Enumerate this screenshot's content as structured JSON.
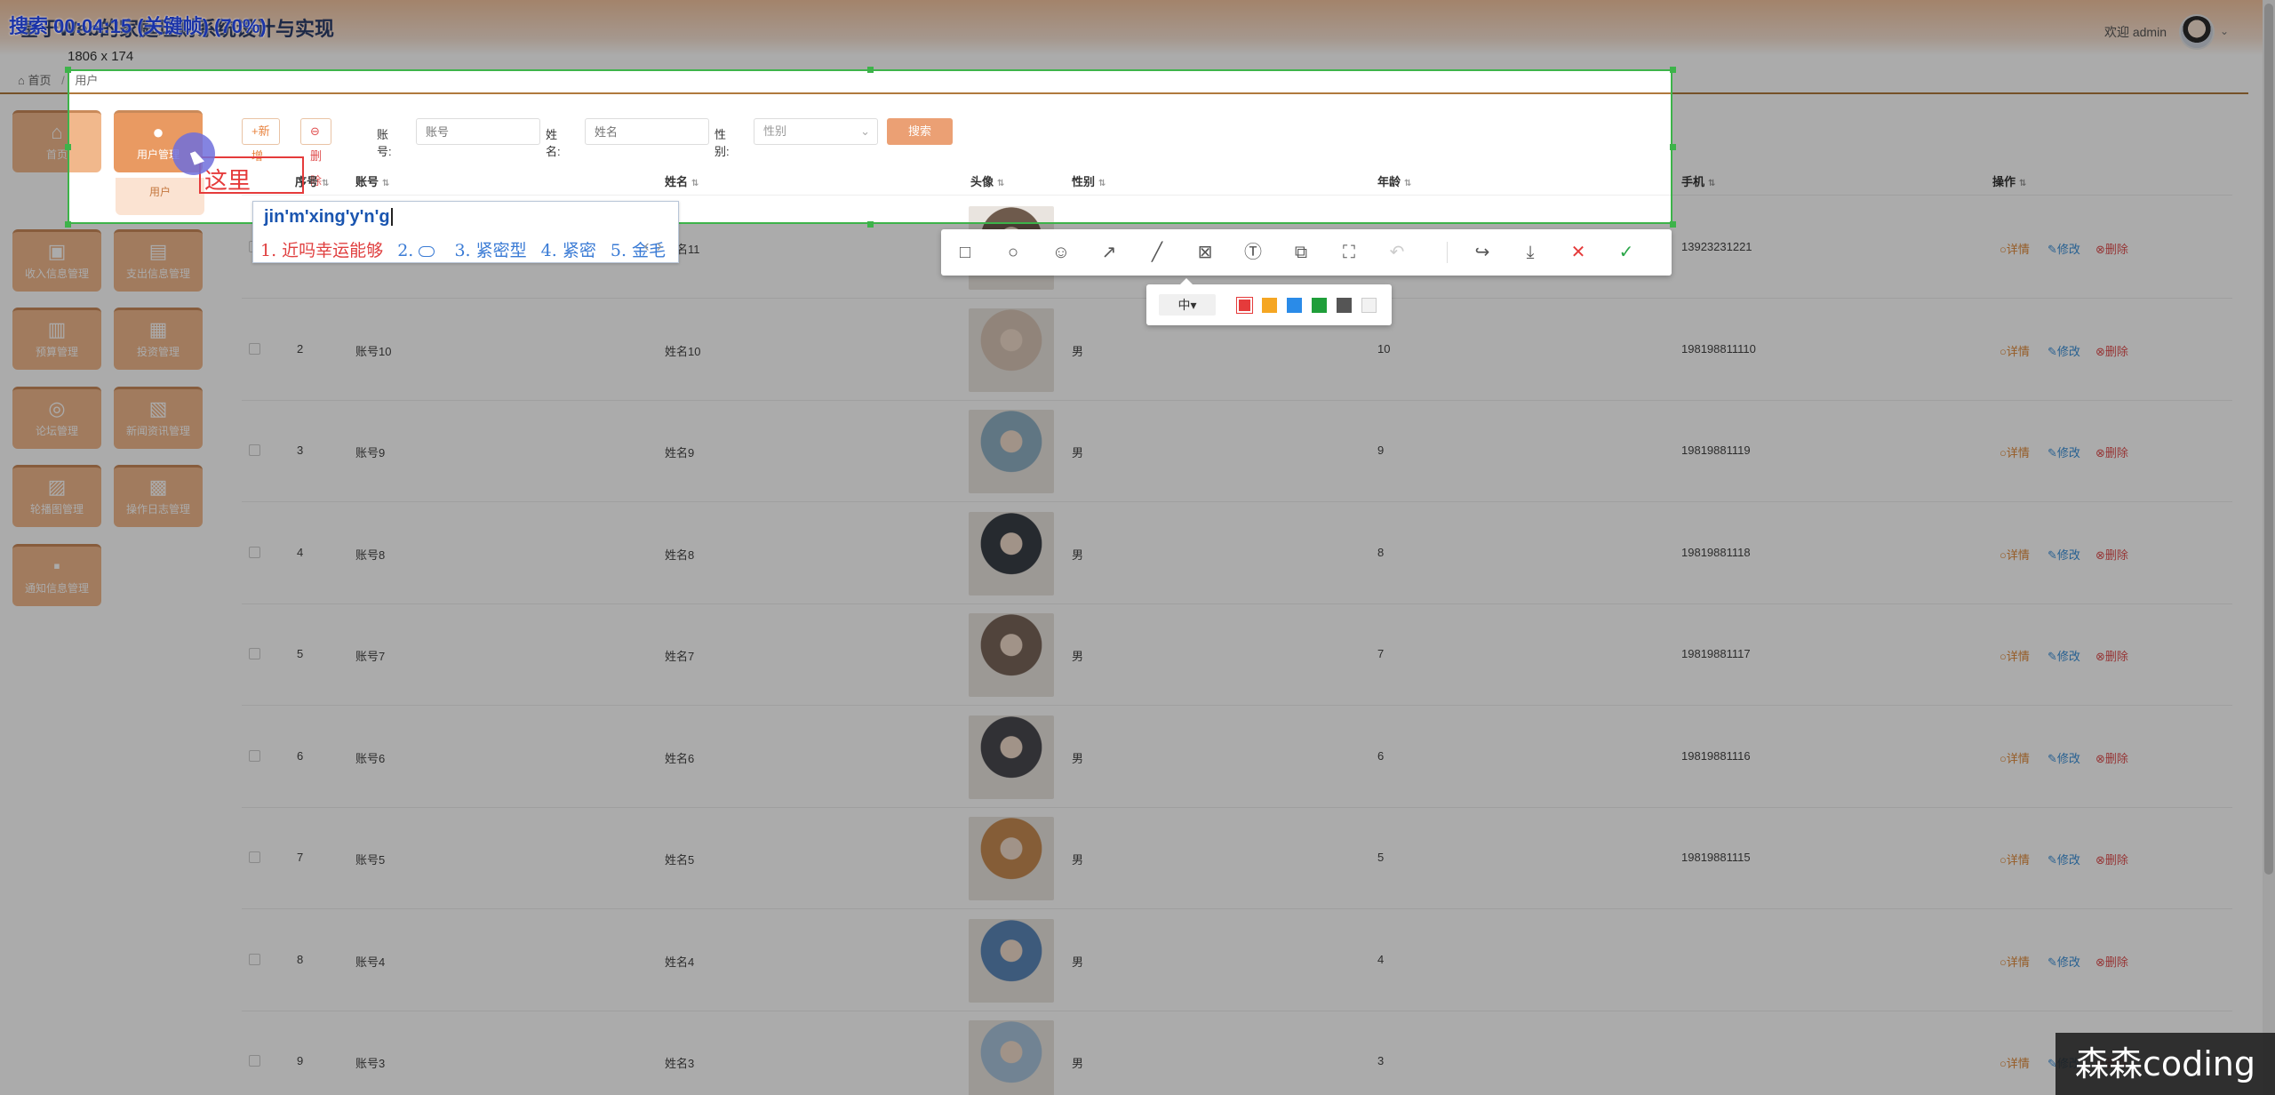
{
  "app": {
    "title": "基于Web的家庭理财系统设计与实现",
    "welcome": "欢迎 admin",
    "caret": "⌄",
    "breadcrumb": {
      "home": "首页",
      "separator": "/",
      "current": "用户"
    }
  },
  "sidebar": {
    "tiles": [
      {
        "label": "首页",
        "icon": "⌂"
      },
      {
        "label": "用户管理",
        "icon": "●",
        "active": true
      },
      {
        "label": "收入信息管理",
        "icon": "▣"
      },
      {
        "label": "支出信息管理",
        "icon": "▤"
      },
      {
        "label": "预算管理",
        "icon": "▥"
      },
      {
        "label": "投资管理",
        "icon": "▦"
      },
      {
        "label": "论坛管理",
        "icon": "◎"
      },
      {
        "label": "新闻资讯管理",
        "icon": "▧"
      },
      {
        "label": "轮播图管理",
        "icon": "▨"
      },
      {
        "label": "操作日志管理",
        "icon": "▩"
      },
      {
        "label": "通知信息管理",
        "icon": "▪"
      }
    ],
    "submenu_label": "用户"
  },
  "toolbar": {
    "add_label": "+新增",
    "delete_label": "⊖删除",
    "account_label": "账号:",
    "account_placeholder": "账号",
    "name_label": "姓名:",
    "name_placeholder": "姓名",
    "gender_label": "性别:",
    "gender_placeholder": "性别",
    "search_label": "搜索"
  },
  "table": {
    "columns": [
      "序号",
      "账号",
      "姓名",
      "头像",
      "性别",
      "年龄",
      "手机",
      "操作"
    ],
    "actions": {
      "detail": "○详情",
      "edit": "✎修改",
      "delete": "⊗删除"
    },
    "rows": [
      {
        "index": "",
        "account": "",
        "name": "姓名11",
        "gender": "",
        "age": "",
        "phone": "13923231221",
        "avatar_color": "#6e5a4c"
      },
      {
        "index": "2",
        "account": "账号10",
        "name": "姓名10",
        "gender": "男",
        "age": "10",
        "phone": "198198811110",
        "avatar_color": "#d8c5b6"
      },
      {
        "index": "3",
        "account": "账号9",
        "name": "姓名9",
        "gender": "男",
        "age": "9",
        "phone": "19819881119",
        "avatar_color": "#8fb0c4"
      },
      {
        "index": "4",
        "account": "账号8",
        "name": "姓名8",
        "gender": "男",
        "age": "8",
        "phone": "19819881118",
        "avatar_color": "#3a3f46"
      },
      {
        "index": "5",
        "account": "账号7",
        "name": "姓名7",
        "gender": "男",
        "age": "7",
        "phone": "19819881117",
        "avatar_color": "#7a665a"
      },
      {
        "index": "6",
        "account": "账号6",
        "name": "姓名6",
        "gender": "男",
        "age": "6",
        "phone": "19819881116",
        "avatar_color": "#4a4a50"
      },
      {
        "index": "7",
        "account": "账号5",
        "name": "姓名5",
        "gender": "男",
        "age": "5",
        "phone": "19819881115",
        "avatar_color": "#c78b52"
      },
      {
        "index": "8",
        "account": "账号4",
        "name": "姓名4",
        "gender": "男",
        "age": "4",
        "phone": "",
        "avatar_color": "#5b86b8"
      },
      {
        "index": "9",
        "account": "账号3",
        "name": "姓名3",
        "gender": "男",
        "age": "3",
        "phone": "",
        "avatar_color": "#a9c4db"
      }
    ]
  },
  "capture": {
    "recording_status": "搜索  00:04:15 (关键帧) (70%)",
    "selection_size": "1806 x 174",
    "annotation_text": "这里",
    "ime": {
      "composition": "jin'm'xing'y'n'g",
      "candidates": [
        "1. 近吗幸运能够",
        "2.",
        "3. 紧密型",
        "4. 紧密",
        "5. 金毛"
      ],
      "nav": "‹›"
    },
    "tools": [
      {
        "name": "rectangle-tool-icon",
        "glyph": "□"
      },
      {
        "name": "ellipse-tool-icon",
        "glyph": "○"
      },
      {
        "name": "emoji-tool-icon",
        "glyph": "☺"
      },
      {
        "name": "arrow-tool-icon",
        "glyph": "↗"
      },
      {
        "name": "line-tool-icon",
        "glyph": "╱"
      },
      {
        "name": "mosaic-tool-icon",
        "glyph": "⊠"
      },
      {
        "name": "text-tool-icon",
        "glyph": "Ⓣ"
      },
      {
        "name": "pin-tool-icon",
        "glyph": "⧉"
      },
      {
        "name": "ocr-tool-icon",
        "glyph": "⛶"
      },
      {
        "name": "undo-icon",
        "glyph": "↶"
      },
      {
        "name": "share-icon",
        "glyph": "↪"
      },
      {
        "name": "download-icon",
        "glyph": "⤓"
      },
      {
        "name": "close-icon",
        "glyph": "✕"
      },
      {
        "name": "confirm-icon",
        "glyph": "✓"
      }
    ],
    "font_size": "中▾",
    "colors": [
      "#e53b3b",
      "#f5a623",
      "#2a8be8",
      "#1f9e3a",
      "#555555",
      "#f2f2f2"
    ],
    "selected_color": "#e53b3b"
  },
  "watermark": "森森coding"
}
